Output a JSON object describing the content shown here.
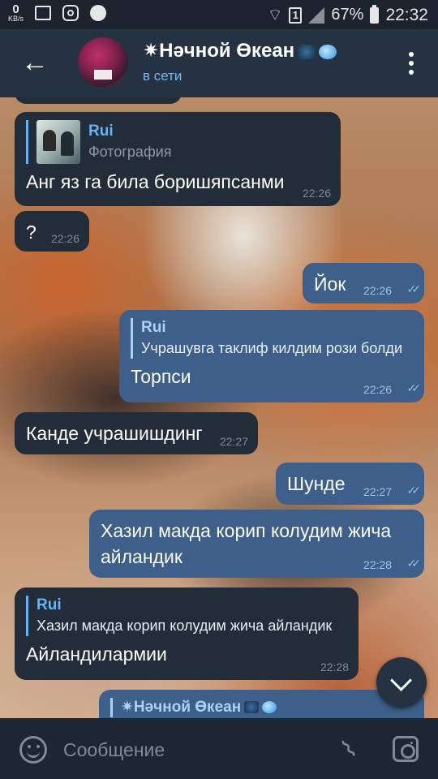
{
  "status_bar": {
    "net_speed_value": "0",
    "net_speed_unit": "KB/s",
    "sim_label": "1",
    "battery": "67%",
    "time": "22:32"
  },
  "header": {
    "title": "✷Нәчной Өкеан",
    "status": "в сети"
  },
  "messages": [
    {
      "reply_name": "Rui",
      "reply_text": "Фотография",
      "text": "Анг яз га била боришяпсанми",
      "time": "22:26"
    },
    {
      "text": "?",
      "time": "22:26"
    },
    {
      "text": "Йок",
      "time": "22:26"
    },
    {
      "reply_name": "Rui",
      "reply_text": "Учрашувга таклиф килдим рози болди",
      "text": "Торпси",
      "time": "22:26"
    },
    {
      "text": "Канде учрашишдинг",
      "time": "22:27"
    },
    {
      "text": "Шунде",
      "time": "22:27"
    },
    {
      "text": "Хазил макда корип колудим жича айландик",
      "time": "22:28"
    },
    {
      "reply_name": "Rui",
      "reply_text": "Хазил макда корип колудим жича айландик",
      "text": "Айландилармии",
      "time": "22:28"
    },
    {
      "reply_name": "✷Нәчной Өкеан"
    }
  ],
  "input": {
    "placeholder": "Сообщение"
  },
  "colors": {
    "header_bg": "#243242",
    "incoming_bubble": "#222d39",
    "outgoing_bubble": "#3d5f8a",
    "accent": "#6ab2f2"
  }
}
